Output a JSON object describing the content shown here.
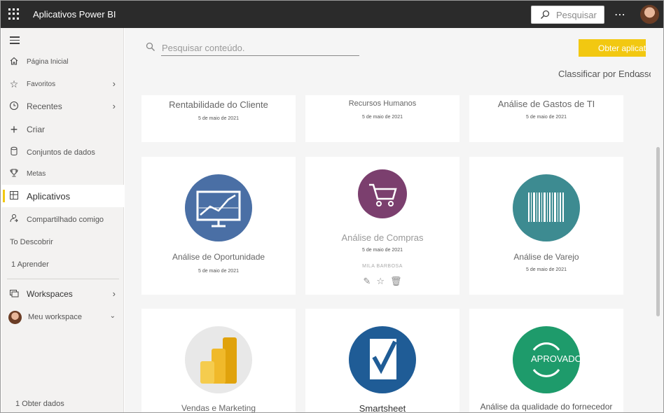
{
  "topbar": {
    "app_title": "Aplicativos Power BI",
    "search_placeholder": "Pesquisar",
    "more_label": "⋯"
  },
  "sidebar": {
    "items": [
      {
        "label": "Página Inicial",
        "icon": "home-icon"
      },
      {
        "label": "Favoritos",
        "icon": "star-icon"
      },
      {
        "label": "Recentes",
        "icon": "clock-icon"
      },
      {
        "label": "Criar",
        "icon": "plus-icon"
      },
      {
        "label": "Conjuntos de dados",
        "icon": "database-icon"
      },
      {
        "label": "Metas",
        "icon": "trophy-icon"
      },
      {
        "label": "Aplicativos",
        "icon": "apps-icon"
      },
      {
        "label": "Compartilhado comigo",
        "icon": "share-icon"
      },
      {
        "label": "To Descobrir"
      },
      {
        "label": "1 Aprender"
      },
      {
        "label": "Workspaces",
        "icon": "workspaces-icon"
      },
      {
        "label": "Meu workspace",
        "icon": "avatar"
      }
    ],
    "get_data": "1 Obter dados"
  },
  "main": {
    "search_placeholder": "Pesquisar conteúdo.",
    "get_apps_label": "Obter aplicativos",
    "sort_label": "Classificar por Endosso",
    "cards": [
      {
        "name": "Rentabilidade do Cliente",
        "date": "5 de maio de 2021"
      },
      {
        "name": "Recursos Humanos",
        "date": "5 de maio de 2021"
      },
      {
        "name": "Análise de Gastos de TI",
        "date": "5 de maio de 2021"
      },
      {
        "name": "Análise de Oportunidade",
        "date": "5 de maio de 2021",
        "logo_color": "#4a6fa5"
      },
      {
        "name": "Análise de Compras",
        "date": "5 de maio de 2021",
        "author": "MILA BARBOSA",
        "logo_color": "#7b3f6e"
      },
      {
        "name": "Análise de Varejo",
        "date": "5 de maio de 2021",
        "logo_color": "#3d8b91"
      },
      {
        "name": "Vendas e Marketing",
        "logo_color": "#e8e8e8"
      },
      {
        "name": "Smartsheet",
        "logo_color": "#1f5c96"
      },
      {
        "name": "Análise da qualidade do fornecedor",
        "logo_text": "APROVADO",
        "logo_color": "#1e9b6b"
      }
    ]
  },
  "colors": {
    "accent": "#f2c811",
    "topbar": "#2b2b2b"
  }
}
